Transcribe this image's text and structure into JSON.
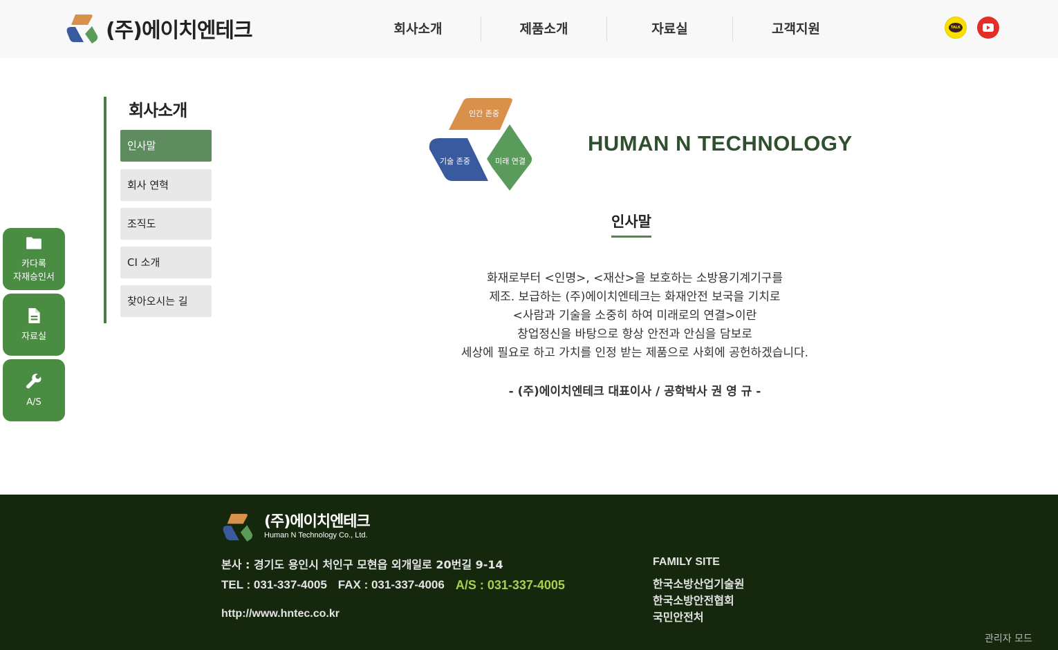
{
  "header": {
    "brand_name": "(주)에이치엔테크",
    "nav": [
      "회사소개",
      "제품소개",
      "자료실",
      "고객지원"
    ],
    "kakao_label": "TALK",
    "sns_icons": [
      "kakaotalk-icon",
      "youtube-icon"
    ]
  },
  "sidebar": {
    "title": "회사소개",
    "items": [
      {
        "label": "인사말",
        "active": true
      },
      {
        "label": "회사 연혁",
        "active": false
      },
      {
        "label": "조직도",
        "active": false
      },
      {
        "label": "CI 소개",
        "active": false
      },
      {
        "label": "찾아오시는 길",
        "active": false
      }
    ]
  },
  "quick_menu": [
    {
      "icon": "folder-icon",
      "label_line1": "카다록",
      "label_line2": "자재승인서"
    },
    {
      "icon": "document-icon",
      "label_line1": "자료실",
      "label_line2": ""
    },
    {
      "icon": "wrench-icon",
      "label_line1": "A/S",
      "label_line2": ""
    }
  ],
  "content": {
    "logo_labels": {
      "top": "인간 존중",
      "left": "기술 존중",
      "right": "미래 연결"
    },
    "company_english": "HUMAN N TECHNOLOGY",
    "section_title": "인사말",
    "greeting_lines": [
      "화재로부터 <인명>, <재산>을 보호하는 소방용기계기구를",
      "제조. 보급하는 (주)에이치엔테크는 화재안전 보국을 기치로",
      "<사람과 기술을 소중히 하여 미래로의 연결>이란",
      "창업정신을 바탕으로 항상 안전과 안심을 담보로",
      "세상에 필요로 하고 가치를 인정 받는 제품으로 사회에 공헌하겠습니다."
    ],
    "signature": "- (주)에이치엔테크 대표이사 / 공학박사 권 영 규 -"
  },
  "footer": {
    "brand_name": "(주)에이치엔테크",
    "brand_sub": "Human N Technology Co., Ltd.",
    "address": "본사 : 경기도 용인시 처인구 모현읍 외개일로 20번길 9-14",
    "tel": "TEL : 031-337-4005",
    "fax": "FAX : 031-337-4006",
    "as": "A/S : 031-337-4005",
    "url": "http://www.hntec.co.kr",
    "family_title": "FAMILY SITE",
    "family_links": [
      "한국소방산업기술원",
      "한국소방안전협회",
      "국민안전처"
    ],
    "admin": "관리자 모드"
  },
  "colors": {
    "brand_green": "#4a8c42",
    "active_menu": "#5e8c5e",
    "footer_bg": "#15280d",
    "logo_orange": "#d9904a",
    "logo_blue": "#3a5aa0",
    "logo_green": "#5a9a5a",
    "as_highlight": "#a6d14a"
  }
}
